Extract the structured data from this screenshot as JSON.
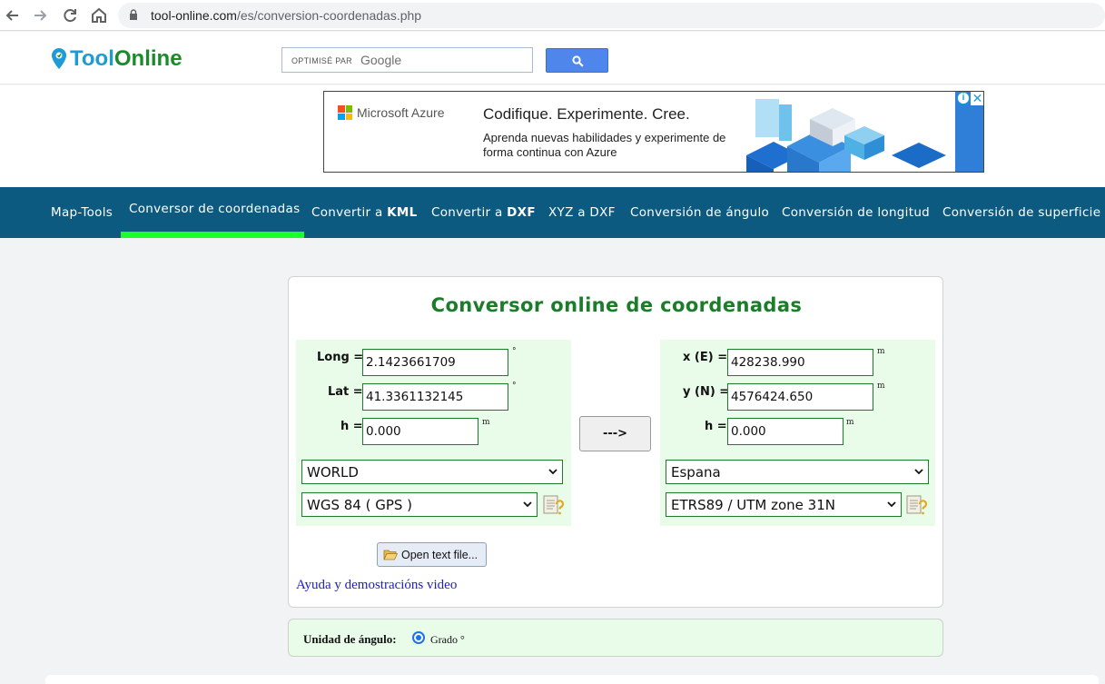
{
  "browser": {
    "url_host": "tool-online.com",
    "url_path": "/es/conversion-coordenadas.php",
    "icons": [
      "back-arrow-icon",
      "forward-arrow-icon",
      "reload-icon",
      "home-icon",
      "lock-icon"
    ]
  },
  "header": {
    "logo_part1": "Tool",
    "logo_part2": "Online",
    "search_optimized": "OPTIMISÉ PAR",
    "search_brand": "Google",
    "search_icon": "search-icon"
  },
  "ad": {
    "brand": "Microsoft Azure",
    "title": "Codifique. Experimente. Cree.",
    "text": "Aprenda nuevas habilidades y experimente de forma continua con Azure",
    "info_glyph": "i",
    "close_glyph": "✕"
  },
  "nav": {
    "items": [
      {
        "label": "Map-Tools",
        "bold": ""
      },
      {
        "label": "Conversor de coordenadas",
        "bold": ""
      },
      {
        "label": "Convertir a ",
        "bold": "KML"
      },
      {
        "label": "Convertir a ",
        "bold": "DXF"
      },
      {
        "label": "XYZ a DXF",
        "bold": ""
      },
      {
        "label": "Conversión de ángulo",
        "bold": ""
      },
      {
        "label": "Conversión de longitud",
        "bold": ""
      },
      {
        "label": "Conversión de superficie",
        "bold": ""
      }
    ],
    "active_index": 1,
    "colors": {
      "bar": "#0d5a80",
      "underline": "#1aff2a"
    }
  },
  "converter": {
    "title": "Conversor online de coordenadas",
    "left": {
      "long_label": "Long =",
      "long_value": "2.1423661709",
      "long_unit": "°",
      "lat_label": "Lat =",
      "lat_value": "41.3361132145",
      "lat_unit": "°",
      "h_label": "h =",
      "h_value": "0.000",
      "h_unit": "m",
      "region": "WORLD",
      "system": "WGS 84 ( GPS )"
    },
    "right": {
      "x_label": "x (E) =",
      "x_value": "428238.990",
      "x_unit": "m",
      "y_label": "y (N) =",
      "y_value": "4576424.650",
      "y_unit": "m",
      "h_label": "h =",
      "h_value": "0.000",
      "h_unit": "m",
      "region": "Espana",
      "system": "ETRS89 / UTM zone 31N"
    },
    "convert_button": "--->",
    "open_file_button": "Open text file...",
    "help_link": "Ayuda y demostracións video"
  },
  "angle_unit": {
    "label": "Unidad de ángulo:",
    "option": "Grado °",
    "selected": true
  }
}
